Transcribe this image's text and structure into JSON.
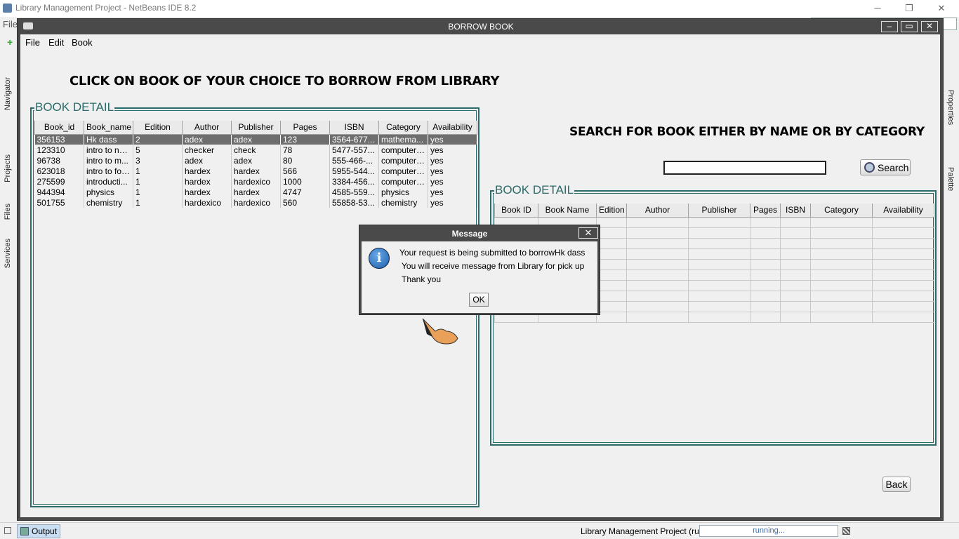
{
  "ide": {
    "title": "Library Management Project - NetBeans IDE 8.2",
    "menu_file": "File",
    "left_tabs": [
      "Navigator",
      "Projects",
      "Files",
      "Services"
    ],
    "right_tabs": [
      "Properties",
      "Palette"
    ],
    "output_tab": "Output",
    "status_project": "Library Management Project (run)",
    "progress_text": "running..."
  },
  "window": {
    "title": "BORROW BOOK",
    "menus": [
      "File",
      "Edit",
      "Book"
    ]
  },
  "main": {
    "instruction": "CLICK ON BOOK OF YOUR CHOICE TO BORROW FROM LIBRARY",
    "search_title": "SEARCH FOR BOOK EITHER BY NAME OR BY CATEGORY",
    "search_value": "",
    "search_button": "Search",
    "back_button": "Back"
  },
  "left_table": {
    "group_label": "BOOK DETAIL",
    "columns": [
      "Book_id",
      "Book_name",
      "Edition",
      "Author",
      "Publisher",
      "Pages",
      "ISBN",
      "Category",
      "Availability"
    ],
    "rows": [
      [
        "356153",
        "Hk dass",
        "2",
        "adex",
        "adex",
        "123",
        "3564-677...",
        "mathema...",
        "yes"
      ],
      [
        "123310",
        "intro to ne...",
        "5",
        "checker",
        "check",
        "78",
        "5477-557...",
        "computer ...",
        "yes"
      ],
      [
        "96738",
        "intro to m...",
        "3",
        "adex",
        "adex",
        "80",
        "555-466-...",
        "computer ...",
        "yes"
      ],
      [
        "623018",
        "intro to for...",
        "1",
        "hardex",
        "hardex",
        "566",
        "5955-544...",
        "computer ...",
        "yes"
      ],
      [
        "275599",
        "introducti...",
        "1",
        "hardex",
        "hardexico",
        "1000",
        "3384-456...",
        "computer ...",
        "yes"
      ],
      [
        "944394",
        "physics",
        "1",
        "hardex",
        "hardex",
        "4747",
        "4585-559...",
        "physics",
        "yes"
      ],
      [
        "501755",
        "chemistry",
        "1",
        "hardexico",
        "hardexico",
        "560",
        "55858-53...",
        "chemistry",
        "yes"
      ]
    ],
    "selected_row": 0
  },
  "right_table": {
    "group_label": "BOOK DETAIL",
    "columns": [
      "Book ID",
      "Book Name",
      "Edition",
      "Author",
      "Publisher",
      "Pages",
      "ISBN",
      "Category",
      "Availability"
    ],
    "empty_rows": 10
  },
  "dialog": {
    "title": "Message",
    "icon": "info-icon",
    "lines": [
      "Your request is being submitted to borrowHk dass",
      "You will receive message from Library for pick up",
      "Thank you"
    ],
    "ok_button": "OK"
  }
}
